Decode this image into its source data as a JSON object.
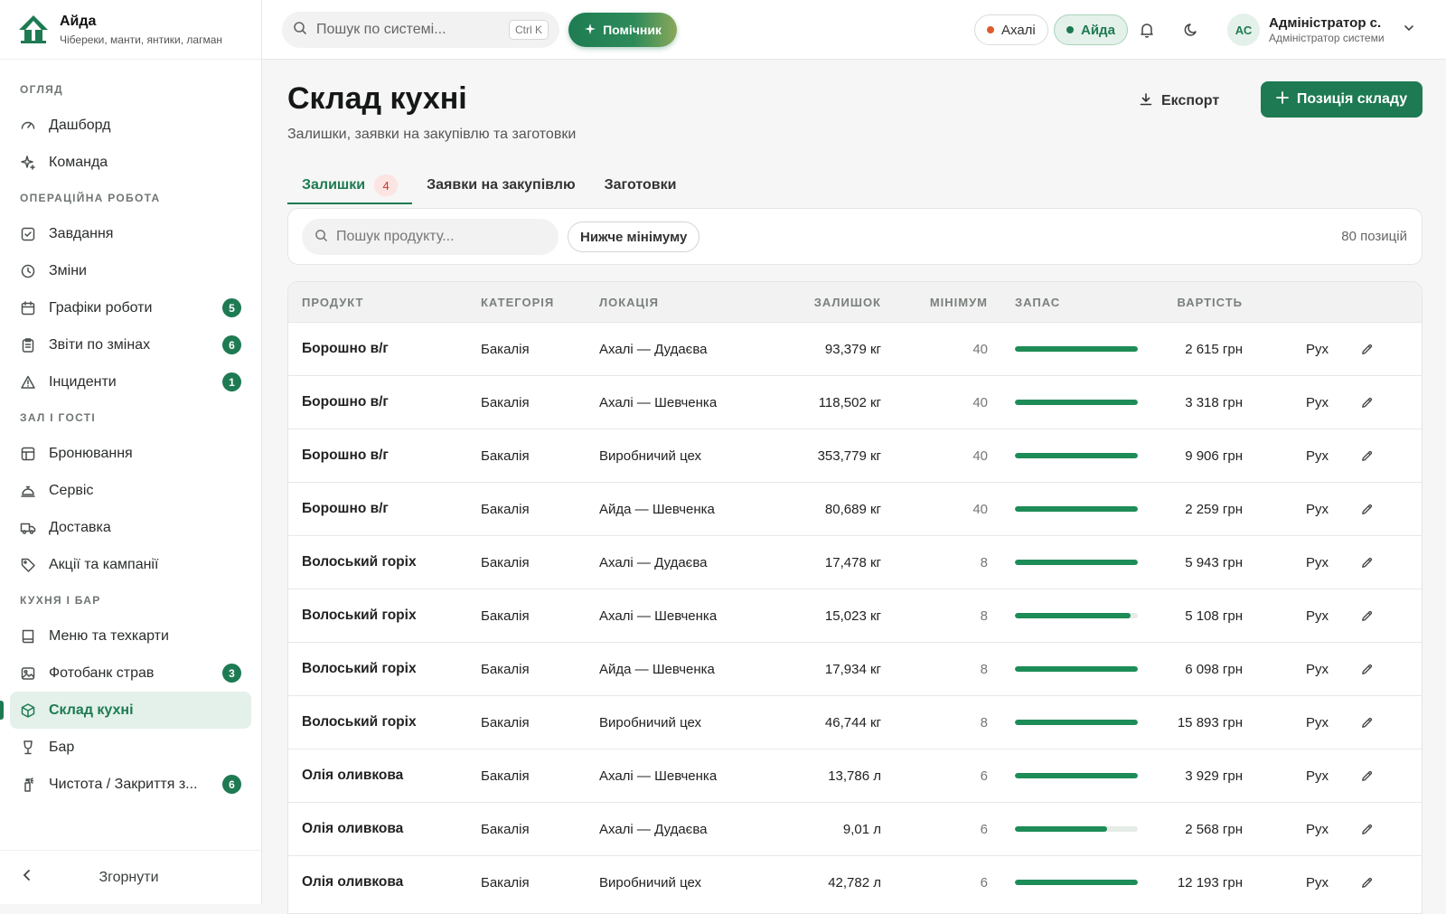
{
  "brand": {
    "name": "Айда",
    "subtitle": "Чібереки, манти, янтики, лагман"
  },
  "sidebar": {
    "sections": [
      {
        "title": "Огляд",
        "items": [
          {
            "label": "Дашборд",
            "icon": "gauge-icon"
          },
          {
            "label": "Команда",
            "icon": "sparkles-icon"
          }
        ]
      },
      {
        "title": "Операційна робота",
        "items": [
          {
            "label": "Завдання",
            "icon": "check-square-icon"
          },
          {
            "label": "Зміни",
            "icon": "clock-icon"
          },
          {
            "label": "Графіки роботи",
            "icon": "calendar-icon",
            "count": "5"
          },
          {
            "label": "Звіти по змінах",
            "icon": "clipboard-icon",
            "count": "6"
          },
          {
            "label": "Інциденти",
            "icon": "warning-icon",
            "count": "1"
          }
        ]
      },
      {
        "title": "Зал і гості",
        "items": [
          {
            "label": "Бронювання",
            "icon": "layout-icon"
          },
          {
            "label": "Сервіс",
            "icon": "bell-service-icon"
          },
          {
            "label": "Доставка",
            "icon": "truck-icon"
          },
          {
            "label": "Акції та кампанії",
            "icon": "tag-icon"
          }
        ]
      },
      {
        "title": "Кухня і бар",
        "items": [
          {
            "label": "Меню та техкарти",
            "icon": "book-icon"
          },
          {
            "label": "Фотобанк страв",
            "icon": "image-icon",
            "count": "3"
          },
          {
            "label": "Склад кухні",
            "icon": "box-icon",
            "active": true
          },
          {
            "label": "Бар",
            "icon": "wine-glass-icon"
          },
          {
            "label": "Чистота / Закриття з...",
            "icon": "spray-icon",
            "count": "6"
          }
        ]
      }
    ],
    "collapse_label": "Згорнути"
  },
  "topbar": {
    "search_placeholder": "Пошук по системі...",
    "search_shortcut": "Ctrl K",
    "assistant_label": "Помічник",
    "locations": [
      {
        "label": "Ахалі",
        "dot_color": "#e05a2b"
      },
      {
        "label": "Айда",
        "dot_color": "#1e7a52",
        "active": true
      }
    ],
    "user": {
      "initials": "АС",
      "name": "Адміністратор с.",
      "role": "Адміністратор системи"
    }
  },
  "page": {
    "title": "Склад кухні",
    "subtitle": "Залишки, заявки на закупівлю та заготовки",
    "export_label": "Експорт",
    "add_label": "Позиція складу"
  },
  "tabs": [
    {
      "label": "Залишки",
      "badge": "4",
      "active": true
    },
    {
      "label": "Заявки на закупівлю"
    },
    {
      "label": "Заготовки"
    }
  ],
  "filters": {
    "search_placeholder": "Пошук продукту...",
    "chip_label": "Нижче мінімуму",
    "count_label": "80 позицій"
  },
  "table": {
    "columns": [
      "Продукт",
      "Категорія",
      "Локація",
      "Залишок",
      "Мінімум",
      "Запас",
      "Вартість"
    ],
    "move_label": "Рух",
    "rows": [
      {
        "product": "Борошно в/г",
        "category": "Бакалія",
        "location": "Ахалі — Дудаєва",
        "stock": "93,379 кг",
        "min": "40",
        "reserve": 1.0,
        "cost": "2 615 грн"
      },
      {
        "product": "Борошно в/г",
        "category": "Бакалія",
        "location": "Ахалі — Шевченка",
        "stock": "118,502 кг",
        "min": "40",
        "reserve": 1.0,
        "cost": "3 318 грн"
      },
      {
        "product": "Борошно в/г",
        "category": "Бакалія",
        "location": "Виробничий цех",
        "stock": "353,779 кг",
        "min": "40",
        "reserve": 1.0,
        "cost": "9 906 грн"
      },
      {
        "product": "Борошно в/г",
        "category": "Бакалія",
        "location": "Айда — Шевченка",
        "stock": "80,689 кг",
        "min": "40",
        "reserve": 1.0,
        "cost": "2 259 грн"
      },
      {
        "product": "Волоський горіх",
        "category": "Бакалія",
        "location": "Ахалі — Дудаєва",
        "stock": "17,478 кг",
        "min": "8",
        "reserve": 1.0,
        "cost": "5 943 грн"
      },
      {
        "product": "Волоський горіх",
        "category": "Бакалія",
        "location": "Ахалі — Шевченка",
        "stock": "15,023 кг",
        "min": "8",
        "reserve": 0.94,
        "cost": "5 108 грн"
      },
      {
        "product": "Волоський горіх",
        "category": "Бакалія",
        "location": "Айда — Шевченка",
        "stock": "17,934 кг",
        "min": "8",
        "reserve": 1.0,
        "cost": "6 098 грн"
      },
      {
        "product": "Волоський горіх",
        "category": "Бакалія",
        "location": "Виробничий цех",
        "stock": "46,744 кг",
        "min": "8",
        "reserve": 1.0,
        "cost": "15 893 грн"
      },
      {
        "product": "Олія оливкова",
        "category": "Бакалія",
        "location": "Ахалі — Шевченка",
        "stock": "13,786 л",
        "min": "6",
        "reserve": 1.0,
        "cost": "3 929 грн"
      },
      {
        "product": "Олія оливкова",
        "category": "Бакалія",
        "location": "Ахалі — Дудаєва",
        "stock": "9,01 л",
        "min": "6",
        "reserve": 0.75,
        "cost": "2 568 грн"
      },
      {
        "product": "Олія оливкова",
        "category": "Бакалія",
        "location": "Виробничий цех",
        "stock": "42,782 л",
        "min": "6",
        "reserve": 1.0,
        "cost": "12 193 грн"
      }
    ]
  },
  "colors": {
    "accent": "#1e7a52",
    "active_bg": "#e4f1ea",
    "danger_badge": "#c0392b"
  }
}
